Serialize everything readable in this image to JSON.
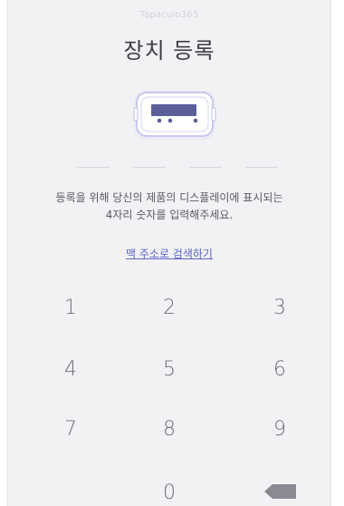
{
  "app": {
    "brand": "Tapaculo365",
    "title": "장치 등록"
  },
  "pin": {
    "slots": 4
  },
  "instructions": {
    "line1": "등록을 위해 당신의 제품의 디스플레이에 표시되는",
    "line2": "4자리 숫자를 입력해주세요."
  },
  "mac_link": "맥 주소로 검색하기",
  "keypad": {
    "k1": "1",
    "k2": "2",
    "k3": "3",
    "k4": "4",
    "k5": "5",
    "k6": "6",
    "k7": "7",
    "k8": "8",
    "k9": "9",
    "k0": "0",
    "backspace_icon": "backspace-icon"
  },
  "colors": {
    "accent": "#5a63c7",
    "device_display": "#5a5f9a",
    "background": "#f2f2f4"
  }
}
